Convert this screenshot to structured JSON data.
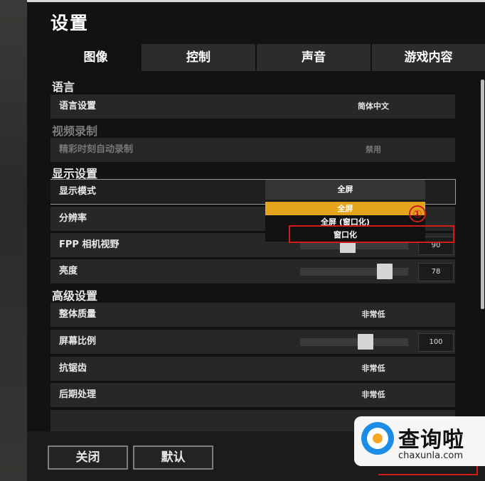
{
  "window": {
    "title": "设置"
  },
  "tabs": [
    {
      "label": "图像",
      "active": true
    },
    {
      "label": "控制",
      "active": false
    },
    {
      "label": "声音",
      "active": false
    },
    {
      "label": "游戏内容",
      "active": false
    }
  ],
  "sections": {
    "language": {
      "title": "语言",
      "rows": {
        "language_setting": {
          "label": "语言设置",
          "value": "简体中文"
        }
      }
    },
    "video_recording": {
      "title": "视频录制",
      "rows": {
        "highlight_autorecord": {
          "label": "精彩时刻自动录制",
          "value": "禁用"
        }
      }
    },
    "display": {
      "title": "显示设置",
      "rows": {
        "display_mode": {
          "label": "显示模式",
          "value": "全屏"
        },
        "resolution": {
          "label": "分辨率"
        },
        "fpp_fov": {
          "label": "FPP 相机视野",
          "value": "90",
          "slider_fraction": 0.45
        },
        "brightness": {
          "label": "亮度",
          "value": "78",
          "slider_fraction": 0.78
        }
      }
    },
    "advanced": {
      "title": "高级设置",
      "rows": {
        "overall_quality": {
          "label": "整体质量",
          "value": "非常低"
        },
        "screen_scale": {
          "label": "屏幕比例",
          "value": "100",
          "slider_fraction": 0.6
        },
        "anti_aliasing": {
          "label": "抗锯齿",
          "value": "非常低"
        },
        "post_processing": {
          "label": "后期处理",
          "value": "非常低"
        }
      }
    }
  },
  "display_mode_dropdown": {
    "selected": "全屏",
    "options": [
      "全屏",
      "全屏 (窗口化)",
      "窗口化"
    ],
    "highlighted": "全屏",
    "annotated": "窗口化",
    "annotation_marker": "①"
  },
  "footer": {
    "close_label": "关闭",
    "default_label": "默认"
  },
  "watermark": {
    "text": "查询啦",
    "sub": "chaxunla.com"
  },
  "colors": {
    "accent": "#e3a31a",
    "annotation_red": "#d11b1b",
    "background": "#121212",
    "row": "#262727"
  }
}
